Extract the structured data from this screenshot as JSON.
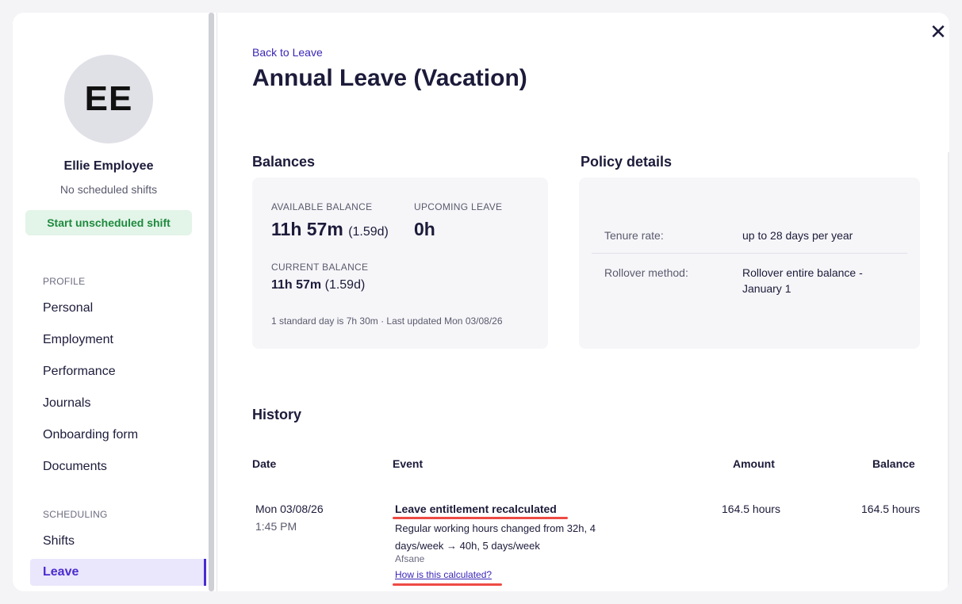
{
  "employee": {
    "initials": "EE",
    "name": "Ellie Employee",
    "status": "No scheduled shifts",
    "start_shift_label": "Start unscheduled shift"
  },
  "sidebar": {
    "profile_section": "PROFILE",
    "profile_items": [
      "Personal",
      "Employment",
      "Performance",
      "Journals",
      "Onboarding form",
      "Documents"
    ],
    "scheduling_section": "SCHEDULING",
    "scheduling_items": [
      "Shifts",
      "Leave"
    ],
    "active_item": "Leave"
  },
  "header": {
    "back_link": "Back to Leave",
    "title": "Annual Leave (Vacation)",
    "close_icon": "close-icon"
  },
  "balances": {
    "heading": "Balances",
    "available_label": "AVAILABLE BALANCE",
    "available_value": "11h 57m",
    "available_days": "(1.59d)",
    "upcoming_label": "UPCOMING LEAVE",
    "upcoming_value": "0h",
    "current_label": "CURRENT BALANCE",
    "current_value": "11h 57m",
    "current_days": "(1.59d)",
    "footnote": "1 standard day is 7h 30m · Last updated Mon 03/08/26"
  },
  "policy": {
    "heading": "Policy details",
    "tenure_label": "Tenure rate:",
    "tenure_value": "up to 28 days per year",
    "rollover_label": "Rollover method:",
    "rollover_value_line1": "Rollover entire balance -",
    "rollover_value_line2": "January 1"
  },
  "history": {
    "heading": "History",
    "columns": {
      "date": "Date",
      "event": "Event",
      "amount": "Amount",
      "balance": "Balance"
    },
    "rows": [
      {
        "date": "Mon 03/08/26",
        "time": "1:45 PM",
        "event_title": "Leave entitlement recalculated",
        "event_desc_line1": "Regular working hours changed from 32h, 4",
        "event_desc_line2": "days/week → 40h, 5 days/week",
        "author": "Afsane",
        "link": "How is this calculated?",
        "amount": "164.5 hours",
        "balance": "164.5 hours"
      }
    ]
  },
  "colors": {
    "accent": "#4b2bd1",
    "success": "#1e8a3e",
    "annotation": "#ee4b44"
  }
}
